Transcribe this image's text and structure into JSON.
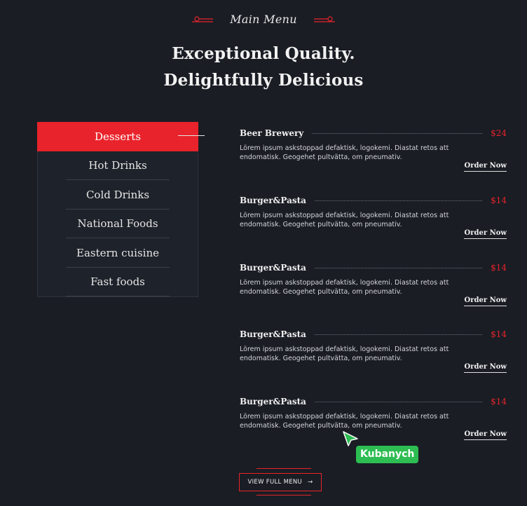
{
  "header": {
    "eyebrow": "Main Menu",
    "heading_line1": "Exceptional Quality.",
    "heading_line2": "Delightfully Delicious"
  },
  "categories": [
    {
      "label": "Desserts",
      "active": true
    },
    {
      "label": "Hot Drinks",
      "active": false
    },
    {
      "label": "Cold Drinks",
      "active": false
    },
    {
      "label": "National Foods",
      "active": false
    },
    {
      "label": "Eastern cuisine",
      "active": false
    },
    {
      "label": "Fast foods",
      "active": false
    }
  ],
  "items": [
    {
      "name": "Beer Brewery",
      "price": "$24",
      "desc": "Lörem ipsum askstoppad defaktisk, logokemi. Diastat retos att endomatisk. Geogehet pultvätta, om pneumativ.",
      "order": "Order Now"
    },
    {
      "name": "Burger&Pasta",
      "price": "$14",
      "desc": "Lörem ipsum askstoppad defaktisk, logokemi. Diastat retos att endomatisk. Geogehet pultvätta, om pneumativ.",
      "order": "Order Now"
    },
    {
      "name": "Burger&Pasta",
      "price": "$14",
      "desc": "Lörem ipsum askstoppad defaktisk, logokemi. Diastat retos att endomatisk. Geogehet pultvätta, om pneumativ.",
      "order": "Order Now"
    },
    {
      "name": "Burger&Pasta",
      "price": "$14",
      "desc": "Lörem ipsum askstoppad defaktisk, logokemi. Diastat retos att endomatisk. Geogehet pultvätta, om pneumativ.",
      "order": "Order Now"
    },
    {
      "name": "Burger&Pasta",
      "price": "$14",
      "desc": "Lörem ipsum askstoppad defaktisk, logokemi. Diastat retos att endomatisk. Geogehet pultvätta, om pneumativ.",
      "order": "Order Now"
    }
  ],
  "cta": {
    "label": "VIEW FULL MENU",
    "arrow": "→"
  },
  "cursor": {
    "user": "Kubanych",
    "icon": "cursor-arrow-icon"
  },
  "colors": {
    "background": "#1a1d24",
    "accent": "#e9232b",
    "cursor_tag": "#2dbd52",
    "text": "#ffffff"
  }
}
